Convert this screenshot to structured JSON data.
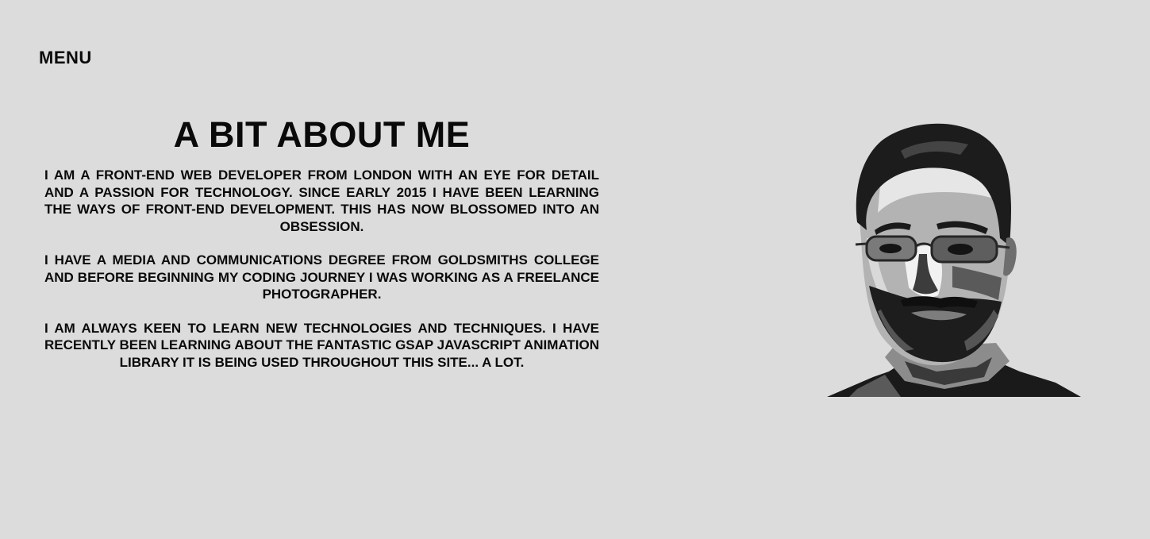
{
  "nav": {
    "menu_label": "MENU"
  },
  "about": {
    "title": "A BIT ABOUT ME",
    "paragraphs": [
      "I am a front-end web developer from London with an eye for detail and a passion for technology. Since early 2015 I have been learning the ways of front-end development. This has now blossomed into an obsession.",
      "I have a media and communications degree from Goldsmiths College and before beginning my coding journey I was working as a freelance photographer.",
      "I am always keen to learn new technologies and techniques. I have recently been learning about the fantastic GSAP JavaScript animation library it is being used throughout this site... a lot."
    ]
  },
  "portrait": {
    "icon": "portrait-photo",
    "style": "grayscale posterized"
  },
  "colors": {
    "background": "#dcdcdc",
    "text": "#0a0a0a"
  }
}
